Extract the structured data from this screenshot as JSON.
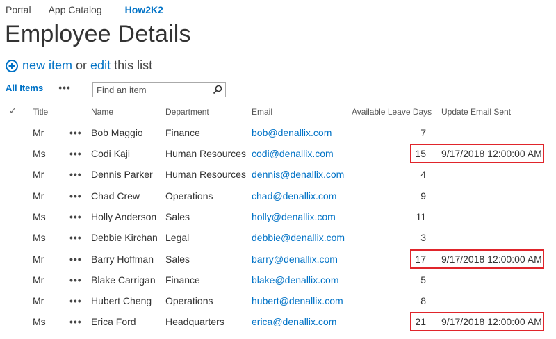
{
  "topnav": {
    "portal": "Portal",
    "app_catalog": "App Catalog",
    "site": "How2K2"
  },
  "page_title": "Employee Details",
  "actions": {
    "new_item": "new item",
    "or": "or",
    "edit": "edit",
    "this_list": "this list"
  },
  "view": {
    "all_items": "All Items",
    "more": "•••"
  },
  "search": {
    "placeholder": "Find an item"
  },
  "columns": {
    "title": "Title",
    "name": "Name",
    "department": "Department",
    "email": "Email",
    "leave": "Available Leave Days",
    "update": "Update Email Sent"
  },
  "rows": [
    {
      "title": "Mr",
      "menu": "•••",
      "name": "Bob Maggio",
      "department": "Finance",
      "email": "bob@denallix.com",
      "leave": "7",
      "update": ""
    },
    {
      "title": "Ms",
      "menu": "•••",
      "name": "Codi Kaji",
      "department": "Human Resources",
      "email": "codi@denallix.com",
      "leave": "15",
      "update": "9/17/2018 12:00:00 AM"
    },
    {
      "title": "Mr",
      "menu": "•••",
      "name": "Dennis Parker",
      "department": "Human Resources",
      "email": "dennis@denallix.com",
      "leave": "4",
      "update": ""
    },
    {
      "title": "Mr",
      "menu": "•••",
      "name": "Chad Crew",
      "department": "Operations",
      "email": "chad@denallix.com",
      "leave": "9",
      "update": ""
    },
    {
      "title": "Ms",
      "menu": "•••",
      "name": "Holly Anderson",
      "department": "Sales",
      "email": "holly@denallix.com",
      "leave": "11",
      "update": ""
    },
    {
      "title": "Ms",
      "menu": "•••",
      "name": "Debbie Kirchan",
      "department": "Legal",
      "email": "debbie@denallix.com",
      "leave": "3",
      "update": ""
    },
    {
      "title": "Mr",
      "menu": "•••",
      "name": "Barry Hoffman",
      "department": "Sales",
      "email": "barry@denallix.com",
      "leave": "17",
      "update": "9/17/2018 12:00:00 AM"
    },
    {
      "title": "Mr",
      "menu": "•••",
      "name": "Blake Carrigan",
      "department": "Finance",
      "email": "blake@denallix.com",
      "leave": "5",
      "update": ""
    },
    {
      "title": "Mr",
      "menu": "•••",
      "name": "Hubert Cheng",
      "department": "Operations",
      "email": "hubert@denallix.com",
      "leave": "8",
      "update": ""
    },
    {
      "title": "Ms",
      "menu": "•••",
      "name": "Erica Ford",
      "department": "Headquarters",
      "email": "erica@denallix.com",
      "leave": "21",
      "update": "9/17/2018 12:00:00 AM"
    }
  ],
  "colors": {
    "link": "#0072c6",
    "highlight": "#e0252b"
  }
}
